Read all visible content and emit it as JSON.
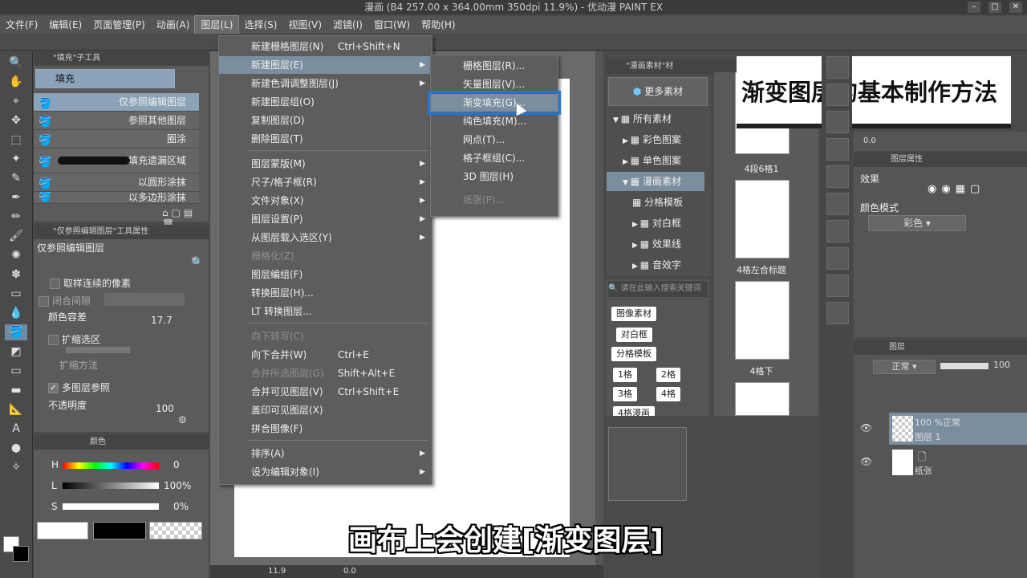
{
  "window": {
    "title": "漫画 (B4 257.00 x 364.00mm 350dpi 11.9%) - 优动漫 PAINT EX",
    "controls": [
      "–",
      "□",
      "✕"
    ]
  },
  "menubar": [
    {
      "label": "文件(F)"
    },
    {
      "label": "编辑(E)"
    },
    {
      "label": "页面管理(P)"
    },
    {
      "label": "动画(A)"
    },
    {
      "label": "图层(L)"
    },
    {
      "label": "选择(S)"
    },
    {
      "label": "视图(V)"
    },
    {
      "label": "滤镜(I)"
    },
    {
      "label": "窗口(W)"
    },
    {
      "label": "帮助(H)"
    }
  ],
  "subtool_panel": {
    "header": "\"填充\"子工具",
    "group": "填充",
    "items": [
      {
        "label": "仅参照编辑图层",
        "selected": true
      },
      {
        "label": "参照其他图层",
        "selected": false
      },
      {
        "label": "圈涂",
        "selected": false
      },
      {
        "label": "填充遗漏区域",
        "selected": false
      },
      {
        "label": "以圆形涂抹",
        "selected": false
      },
      {
        "label": "以多边形涂抹",
        "selected": false
      }
    ]
  },
  "tool_property": {
    "header": "\"仅参照编辑图层\"工具属性",
    "name": "仅参照编辑图层",
    "contiguous": "取样连续的像素",
    "close_gap": "闭合间隙",
    "color_tolerance_label": "颜色容差",
    "color_tolerance_value": "17.7",
    "expand": "扩缩选区",
    "expand_method": "扩缩方法",
    "multi_ref": "多图层参照",
    "opacity_label": "不透明度",
    "opacity_value": "100"
  },
  "color_panel": {
    "header": "颜色",
    "h_label": "H",
    "h_value": "0",
    "l_label": "L",
    "l_value": "100%",
    "s_label": "S",
    "s_value": "0%"
  },
  "layer_menu": {
    "items": [
      {
        "label": "新建栅格图层(N)",
        "shortcut": "Ctrl+Shift+N",
        "sub": false,
        "disabled": false
      },
      {
        "label": "新建图层(E)",
        "shortcut": "",
        "sub": true,
        "disabled": false,
        "highlight": true
      },
      {
        "label": "新建色调调整图层(J)",
        "shortcut": "",
        "sub": true,
        "disabled": false
      },
      {
        "label": "新建图层组(O)",
        "shortcut": "",
        "sub": false,
        "disabled": false
      },
      {
        "label": "复制图层(D)",
        "shortcut": "",
        "sub": false,
        "disabled": false
      },
      {
        "label": "删除图层(T)",
        "shortcut": "",
        "sub": false,
        "disabled": false
      },
      {
        "sep": true
      },
      {
        "label": "图层蒙版(M)",
        "shortcut": "",
        "sub": true,
        "disabled": false
      },
      {
        "label": "尺子/格子框(R)",
        "shortcut": "",
        "sub": true,
        "disabled": false
      },
      {
        "label": "文件对象(X)",
        "shortcut": "",
        "sub": true,
        "disabled": false
      },
      {
        "label": "图层设置(P)",
        "shortcut": "",
        "sub": true,
        "disabled": false
      },
      {
        "label": "从图层载入选区(Y)",
        "shortcut": "",
        "sub": true,
        "disabled": false
      },
      {
        "label": "栅格化(Z)",
        "shortcut": "",
        "sub": false,
        "disabled": true
      },
      {
        "label": "图层编组(F)",
        "shortcut": "",
        "sub": false,
        "disabled": false
      },
      {
        "label": "转换图层(H)...",
        "shortcut": "",
        "sub": false,
        "disabled": false
      },
      {
        "label": "LT 转换图层...",
        "shortcut": "",
        "sub": false,
        "disabled": false
      },
      {
        "sep": true
      },
      {
        "label": "向下转写(C)",
        "shortcut": "",
        "sub": false,
        "disabled": true
      },
      {
        "label": "向下合并(W)",
        "shortcut": "Ctrl+E",
        "sub": false,
        "disabled": false
      },
      {
        "label": "合并所选图层(G)",
        "shortcut": "Shift+Alt+E",
        "sub": false,
        "disabled": true
      },
      {
        "label": "合并可见图层(V)",
        "shortcut": "Ctrl+Shift+E",
        "sub": false,
        "disabled": false
      },
      {
        "label": "盖印可见图层(X)",
        "shortcut": "",
        "sub": false,
        "disabled": false
      },
      {
        "label": "拼合图像(F)",
        "shortcut": "",
        "sub": false,
        "disabled": false
      },
      {
        "sep": true
      },
      {
        "label": "排序(A)",
        "shortcut": "",
        "sub": true,
        "disabled": false
      },
      {
        "label": "设为编辑对象(I)",
        "shortcut": "",
        "sub": true,
        "disabled": false
      }
    ]
  },
  "submenu": {
    "items": [
      {
        "label": "栅格图层(R)...",
        "disabled": false
      },
      {
        "label": "矢量图层(V)...",
        "disabled": false
      },
      {
        "label": "渐变填充(G)...",
        "disabled": false,
        "highlight": true
      },
      {
        "label": "纯色填充(M)...",
        "disabled": false
      },
      {
        "label": "网点(T)...",
        "disabled": false
      },
      {
        "label": "格子框组(C)...",
        "disabled": false
      },
      {
        "label": "3D 图层(H)",
        "disabled": false
      },
      {
        "label": "纸张(P)...",
        "disabled": true
      }
    ]
  },
  "material_panel": {
    "header": "\"漫画素材\"材",
    "more": "更多素材",
    "tree": [
      {
        "label": "所有素材",
        "level": 0,
        "arrow": "▼"
      },
      {
        "label": "彩色图案",
        "level": 1,
        "arrow": "▶"
      },
      {
        "label": "单色图案",
        "level": 1,
        "arrow": "▶"
      },
      {
        "label": "漫画素材",
        "level": 1,
        "arrow": "▼",
        "selected": true
      },
      {
        "label": "分格模板",
        "level": 2,
        "arrow": ""
      },
      {
        "label": "对白框",
        "level": 2,
        "arrow": "▶"
      },
      {
        "label": "效果线",
        "level": 2,
        "arrow": "▶"
      },
      {
        "label": "音效字",
        "level": 2,
        "arrow": "▶"
      }
    ],
    "search_placeholder": "请在此输入搜索关键词",
    "tags": [
      "图像素材",
      "对白框",
      "分格模板",
      "1格",
      "2格",
      "3格",
      "4格",
      "4格漫画"
    ],
    "thumbs": [
      {
        "caption": "4段6格1"
      },
      {
        "caption": "4格左合标题"
      },
      {
        "caption": "4格下"
      }
    ]
  },
  "layer_property": {
    "header": "图层属性",
    "effect": "效果",
    "color_mode_label": "颜色模式",
    "color_mode_value": "彩色"
  },
  "layers_panel": {
    "header": "图层",
    "blend": "正常",
    "opacity": "100",
    "layers": [
      {
        "line1": "100 %正常",
        "line2": "图层 1"
      },
      {
        "line1": "",
        "line2": "纸张"
      }
    ]
  },
  "navigator": {
    "value": "0.0"
  },
  "statusbar": {
    "zoom": "11.9",
    "angle": "0.0"
  },
  "caption_title": "渐变图层的基本制作方法",
  "subtitle": "画布上会创建[渐变图层]",
  "colors": {
    "highlight": "#7b8ea0",
    "callout": "#1e78d8"
  }
}
